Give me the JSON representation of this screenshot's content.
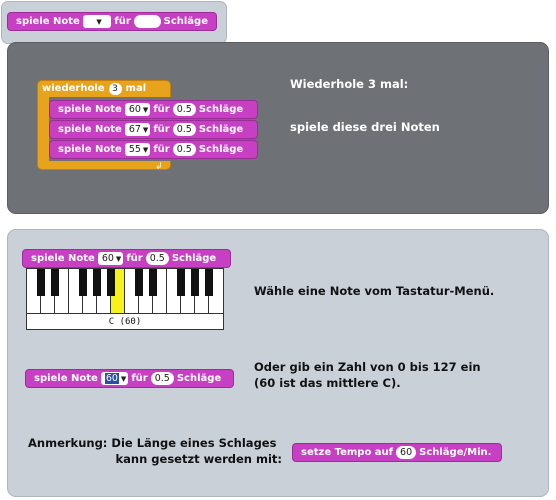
{
  "top_block": {
    "prefix": "spiele Note",
    "mid": "für",
    "suffix": "Schläge"
  },
  "repeat_example": {
    "repeat_label": "wiederhole",
    "repeat_count": "3",
    "repeat_suffix": "mal",
    "notes": [
      {
        "prefix": "spiele Note",
        "note": "60",
        "mid": "für",
        "beats": "0.5",
        "suffix": "Schläge"
      },
      {
        "prefix": "spiele Note",
        "note": "67",
        "mid": "für",
        "beats": "0.5",
        "suffix": "Schläge"
      },
      {
        "prefix": "spiele Note",
        "note": "55",
        "mid": "für",
        "beats": "0.5",
        "suffix": "Schläge"
      }
    ],
    "caption_line1": "Wiederhole 3 mal:",
    "caption_line2": "spiele diese drei Noten"
  },
  "keyboard_example": {
    "block": {
      "prefix": "spiele Note",
      "note": "60",
      "mid": "für",
      "beats": "0.5",
      "suffix": "Schläge"
    },
    "note_name": "C (60)",
    "caption": "Wähle eine Note vom Tastatur-Menü."
  },
  "number_example": {
    "block": {
      "prefix": "spiele Note",
      "note": "60",
      "mid": "für",
      "beats": "0.5",
      "suffix": "Schläge"
    },
    "caption_line1": "Oder gib ein Zahl von 0 bis 127 ein",
    "caption_line2": "(60 ist das mittlere C)."
  },
  "tempo_example": {
    "caption_line1": "Anmerkung: Die Länge eines Schlages",
    "caption_line2": "kann gesetzt werden mit:",
    "block": {
      "prefix": "setze Tempo auf",
      "value": "60",
      "suffix": "Schläge/Min."
    }
  },
  "colors": {
    "sound_block": "#c740c3",
    "control_block": "#e8a31c",
    "dark_panel": "#6e7276",
    "light_panel": "#c9d0d8",
    "highlight_key": "#f7f21a"
  }
}
